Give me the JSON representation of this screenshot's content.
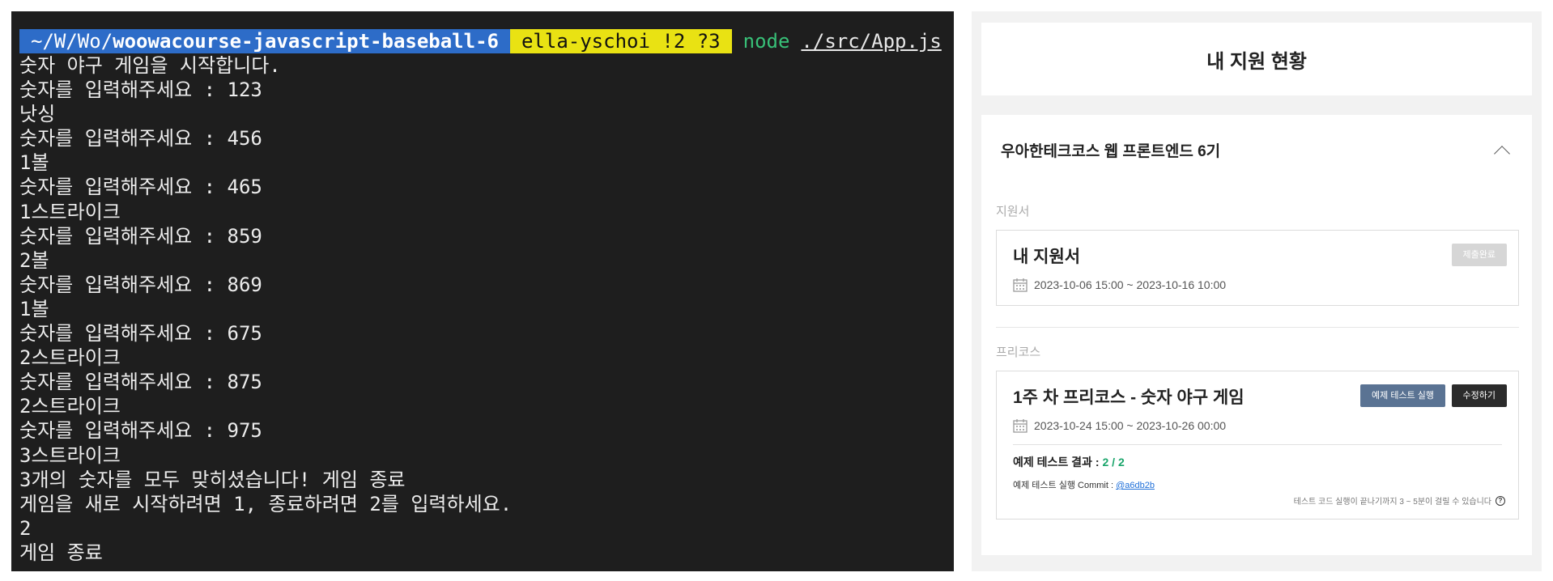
{
  "terminal": {
    "prompt": {
      "path_prefix": "~/W/Wo/",
      "path_bold": "woowacourse-javascript-baseball-6",
      "git": "ella-yschoi !2 ?3",
      "command": "node",
      "argument": "./src/App.js"
    },
    "lines": [
      "숫자 야구 게임을 시작합니다.",
      "숫자를 입력해주세요 : 123",
      "낫싱",
      "숫자를 입력해주세요 : 456",
      "1볼",
      "숫자를 입력해주세요 : 465",
      "1스트라이크",
      "숫자를 입력해주세요 : 859",
      "2볼",
      "숫자를 입력해주세요 : 869",
      "1볼",
      "숫자를 입력해주세요 : 675",
      "2스트라이크",
      "숫자를 입력해주세요 : 875",
      "2스트라이크",
      "숫자를 입력해주세요 : 975",
      "3스트라이크",
      "3개의 숫자를 모두 맞히셨습니다! 게임 종료",
      "게임을 새로 시작하려면 1, 종료하려면 2를 입력하세요.",
      "2",
      "게임 종료"
    ]
  },
  "panel": {
    "page_title": "내 지원 현황",
    "course_title": "우아한테크코스 웹 프론트엔드 6기",
    "application": {
      "section_label": "지원서",
      "title": "내 지원서",
      "date_range": "2023-10-06 15:00 ~ 2023-10-16 10:00",
      "status_button": "제출완료"
    },
    "precourse": {
      "section_label": "프리코스",
      "title": "1주 차 프리코스 - 숫자 야구 게임",
      "date_range": "2023-10-24 15:00 ~ 2023-10-26 00:00",
      "test_button": "예제 테스트 실행",
      "edit_button": "수정하기",
      "result_label": "예제 테스트 결과 :",
      "result_value": "2 / 2",
      "commit_label": "예제 테스트 실행 Commit : ",
      "commit_hash": "@a6db2b",
      "note": "테스트 코드 실행이 끝나기까지 3 ~ 5분이 걸릴 수 있습니다"
    }
  },
  "icons": {
    "calendar": "calendar-icon",
    "chevron": "chevron-up-icon",
    "help": "help-circle-icon"
  },
  "colors": {
    "terminal_bg": "#1e1e1e",
    "path_bg": "#2d6cc8",
    "git_bg": "#e9e213",
    "command": "#38c178",
    "test_button": "#5a7393",
    "edit_button": "#2b2b2b",
    "result_green": "#1aa56b",
    "link_blue": "#1e6fd9"
  }
}
